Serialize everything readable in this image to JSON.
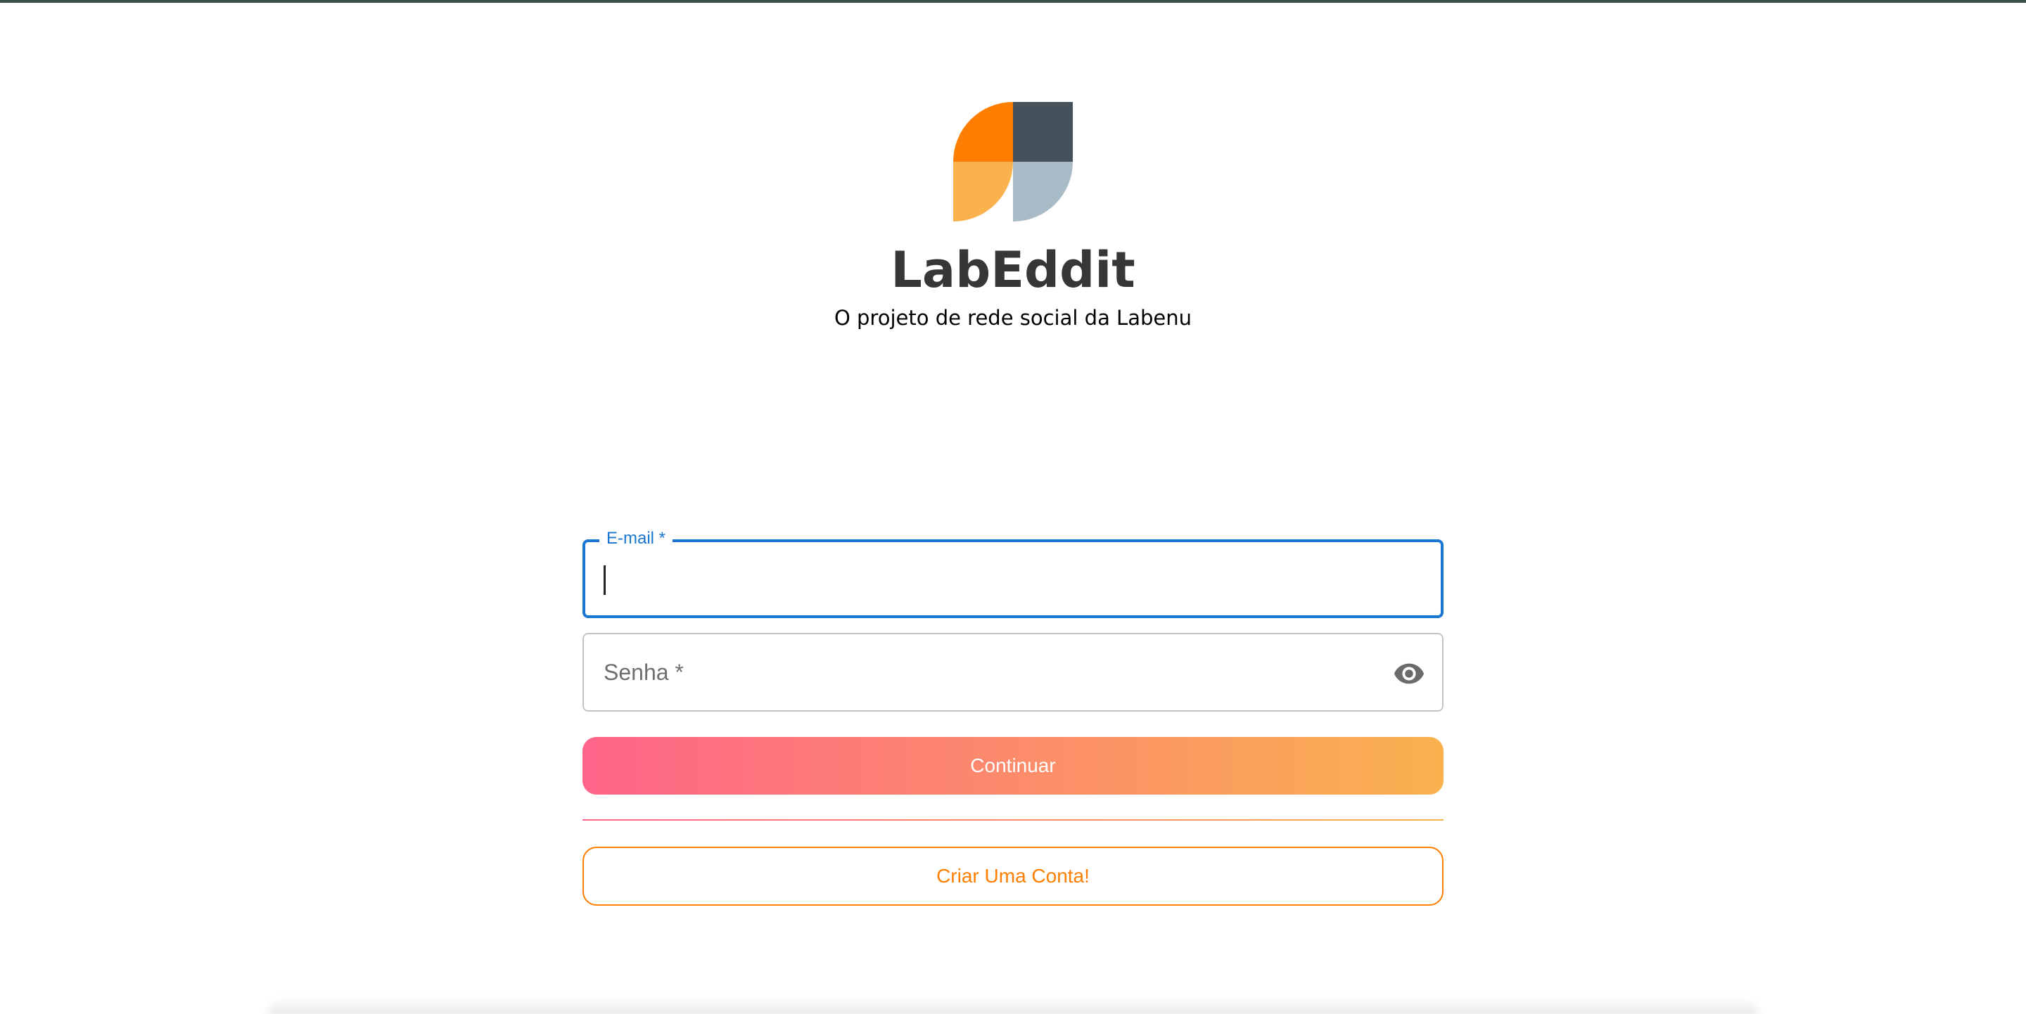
{
  "app": {
    "title": "LabEddit",
    "subtitle": "O projeto de rede social da Labenu",
    "logo_icon": "labeddit-logo",
    "logo_colors": [
      "#fe7e02",
      "#45525b",
      "#f9b24e",
      "#a8bbc6"
    ]
  },
  "login_form": {
    "email": {
      "label": "E-mail *",
      "value": ""
    },
    "password": {
      "placeholder": "Senha *",
      "value": "",
      "toggle_icon": "eye-icon"
    },
    "continue_label": "Continuar",
    "create_account_label": "Criar Uma Conta!"
  },
  "colors": {
    "accent_blue": "#1976d2",
    "gradient_start": "#ff6489",
    "gradient_end": "#f9b24e",
    "orange": "#fe7e02"
  }
}
